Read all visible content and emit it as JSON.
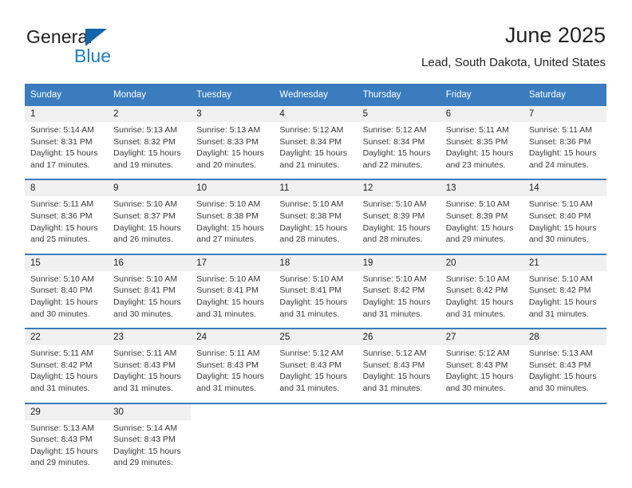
{
  "brand": {
    "name_top": "General",
    "name_bottom": "Blue",
    "accent_color": "#1f7ec4",
    "triangle_color": "#1464aa"
  },
  "header": {
    "title": "June 2025",
    "subtitle": "Lead, South Dakota, United States"
  },
  "calendar": {
    "header_bg": "#3a7cbe",
    "daynum_bg": "#f0f0f0",
    "weekdays": [
      "Sunday",
      "Monday",
      "Tuesday",
      "Wednesday",
      "Thursday",
      "Friday",
      "Saturday"
    ],
    "weeks": [
      [
        {
          "day": "1",
          "sunrise": "Sunrise: 5:14 AM",
          "sunset": "Sunset: 8:31 PM",
          "daylight1": "Daylight: 15 hours",
          "daylight2": "and 17 minutes."
        },
        {
          "day": "2",
          "sunrise": "Sunrise: 5:13 AM",
          "sunset": "Sunset: 8:32 PM",
          "daylight1": "Daylight: 15 hours",
          "daylight2": "and 19 minutes."
        },
        {
          "day": "3",
          "sunrise": "Sunrise: 5:13 AM",
          "sunset": "Sunset: 8:33 PM",
          "daylight1": "Daylight: 15 hours",
          "daylight2": "and 20 minutes."
        },
        {
          "day": "4",
          "sunrise": "Sunrise: 5:12 AM",
          "sunset": "Sunset: 8:34 PM",
          "daylight1": "Daylight: 15 hours",
          "daylight2": "and 21 minutes."
        },
        {
          "day": "5",
          "sunrise": "Sunrise: 5:12 AM",
          "sunset": "Sunset: 8:34 PM",
          "daylight1": "Daylight: 15 hours",
          "daylight2": "and 22 minutes."
        },
        {
          "day": "6",
          "sunrise": "Sunrise: 5:11 AM",
          "sunset": "Sunset: 8:35 PM",
          "daylight1": "Daylight: 15 hours",
          "daylight2": "and 23 minutes."
        },
        {
          "day": "7",
          "sunrise": "Sunrise: 5:11 AM",
          "sunset": "Sunset: 8:36 PM",
          "daylight1": "Daylight: 15 hours",
          "daylight2": "and 24 minutes."
        }
      ],
      [
        {
          "day": "8",
          "sunrise": "Sunrise: 5:11 AM",
          "sunset": "Sunset: 8:36 PM",
          "daylight1": "Daylight: 15 hours",
          "daylight2": "and 25 minutes."
        },
        {
          "day": "9",
          "sunrise": "Sunrise: 5:10 AM",
          "sunset": "Sunset: 8:37 PM",
          "daylight1": "Daylight: 15 hours",
          "daylight2": "and 26 minutes."
        },
        {
          "day": "10",
          "sunrise": "Sunrise: 5:10 AM",
          "sunset": "Sunset: 8:38 PM",
          "daylight1": "Daylight: 15 hours",
          "daylight2": "and 27 minutes."
        },
        {
          "day": "11",
          "sunrise": "Sunrise: 5:10 AM",
          "sunset": "Sunset: 8:38 PM",
          "daylight1": "Daylight: 15 hours",
          "daylight2": "and 28 minutes."
        },
        {
          "day": "12",
          "sunrise": "Sunrise: 5:10 AM",
          "sunset": "Sunset: 8:39 PM",
          "daylight1": "Daylight: 15 hours",
          "daylight2": "and 28 minutes."
        },
        {
          "day": "13",
          "sunrise": "Sunrise: 5:10 AM",
          "sunset": "Sunset: 8:39 PM",
          "daylight1": "Daylight: 15 hours",
          "daylight2": "and 29 minutes."
        },
        {
          "day": "14",
          "sunrise": "Sunrise: 5:10 AM",
          "sunset": "Sunset: 8:40 PM",
          "daylight1": "Daylight: 15 hours",
          "daylight2": "and 30 minutes."
        }
      ],
      [
        {
          "day": "15",
          "sunrise": "Sunrise: 5:10 AM",
          "sunset": "Sunset: 8:40 PM",
          "daylight1": "Daylight: 15 hours",
          "daylight2": "and 30 minutes."
        },
        {
          "day": "16",
          "sunrise": "Sunrise: 5:10 AM",
          "sunset": "Sunset: 8:41 PM",
          "daylight1": "Daylight: 15 hours",
          "daylight2": "and 30 minutes."
        },
        {
          "day": "17",
          "sunrise": "Sunrise: 5:10 AM",
          "sunset": "Sunset: 8:41 PM",
          "daylight1": "Daylight: 15 hours",
          "daylight2": "and 31 minutes."
        },
        {
          "day": "18",
          "sunrise": "Sunrise: 5:10 AM",
          "sunset": "Sunset: 8:41 PM",
          "daylight1": "Daylight: 15 hours",
          "daylight2": "and 31 minutes."
        },
        {
          "day": "19",
          "sunrise": "Sunrise: 5:10 AM",
          "sunset": "Sunset: 8:42 PM",
          "daylight1": "Daylight: 15 hours",
          "daylight2": "and 31 minutes."
        },
        {
          "day": "20",
          "sunrise": "Sunrise: 5:10 AM",
          "sunset": "Sunset: 8:42 PM",
          "daylight1": "Daylight: 15 hours",
          "daylight2": "and 31 minutes."
        },
        {
          "day": "21",
          "sunrise": "Sunrise: 5:10 AM",
          "sunset": "Sunset: 8:42 PM",
          "daylight1": "Daylight: 15 hours",
          "daylight2": "and 31 minutes."
        }
      ],
      [
        {
          "day": "22",
          "sunrise": "Sunrise: 5:11 AM",
          "sunset": "Sunset: 8:42 PM",
          "daylight1": "Daylight: 15 hours",
          "daylight2": "and 31 minutes."
        },
        {
          "day": "23",
          "sunrise": "Sunrise: 5:11 AM",
          "sunset": "Sunset: 8:43 PM",
          "daylight1": "Daylight: 15 hours",
          "daylight2": "and 31 minutes."
        },
        {
          "day": "24",
          "sunrise": "Sunrise: 5:11 AM",
          "sunset": "Sunset: 8:43 PM",
          "daylight1": "Daylight: 15 hours",
          "daylight2": "and 31 minutes."
        },
        {
          "day": "25",
          "sunrise": "Sunrise: 5:12 AM",
          "sunset": "Sunset: 8:43 PM",
          "daylight1": "Daylight: 15 hours",
          "daylight2": "and 31 minutes."
        },
        {
          "day": "26",
          "sunrise": "Sunrise: 5:12 AM",
          "sunset": "Sunset: 8:43 PM",
          "daylight1": "Daylight: 15 hours",
          "daylight2": "and 31 minutes."
        },
        {
          "day": "27",
          "sunrise": "Sunrise: 5:12 AM",
          "sunset": "Sunset: 8:43 PM",
          "daylight1": "Daylight: 15 hours",
          "daylight2": "and 30 minutes."
        },
        {
          "day": "28",
          "sunrise": "Sunrise: 5:13 AM",
          "sunset": "Sunset: 8:43 PM",
          "daylight1": "Daylight: 15 hours",
          "daylight2": "and 30 minutes."
        }
      ],
      [
        {
          "day": "29",
          "sunrise": "Sunrise: 5:13 AM",
          "sunset": "Sunset: 8:43 PM",
          "daylight1": "Daylight: 15 hours",
          "daylight2": "and 29 minutes."
        },
        {
          "day": "30",
          "sunrise": "Sunrise: 5:14 AM",
          "sunset": "Sunset: 8:43 PM",
          "daylight1": "Daylight: 15 hours",
          "daylight2": "and 29 minutes."
        },
        {
          "day": "",
          "sunrise": "",
          "sunset": "",
          "daylight1": "",
          "daylight2": ""
        },
        {
          "day": "",
          "sunrise": "",
          "sunset": "",
          "daylight1": "",
          "daylight2": ""
        },
        {
          "day": "",
          "sunrise": "",
          "sunset": "",
          "daylight1": "",
          "daylight2": ""
        },
        {
          "day": "",
          "sunrise": "",
          "sunset": "",
          "daylight1": "",
          "daylight2": ""
        },
        {
          "day": "",
          "sunrise": "",
          "sunset": "",
          "daylight1": "",
          "daylight2": ""
        }
      ]
    ]
  }
}
